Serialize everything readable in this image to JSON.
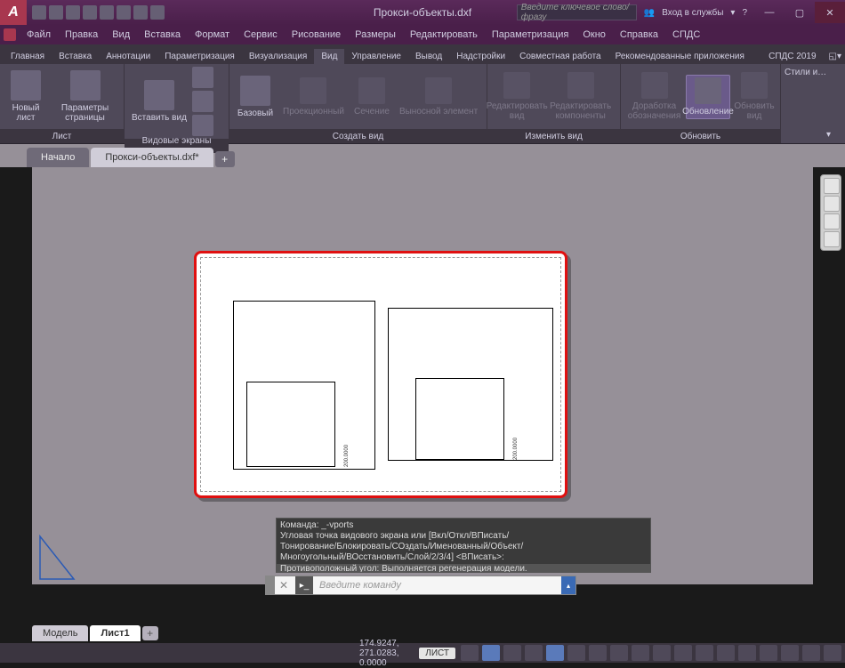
{
  "title": "Прокси-объекты.dxf",
  "search_placeholder": "Введите ключевое слово/фразу",
  "signin": "Вход в службы",
  "menubar": [
    "Файл",
    "Правка",
    "Вид",
    "Вставка",
    "Формат",
    "Сервис",
    "Рисование",
    "Размеры",
    "Редактировать",
    "Параметризация",
    "Окно",
    "Справка",
    "СПДС"
  ],
  "rtabs": [
    "Главная",
    "Вставка",
    "Аннотации",
    "Параметризация",
    "Визуализация",
    "Вид",
    "Управление",
    "Вывод",
    "Надстройки",
    "Совместная работа",
    "Рекомендованные приложения"
  ],
  "rtabs_active": 5,
  "rtabs_right": "СПДС 2019",
  "panels": {
    "sheet": {
      "title": "Лист",
      "new": "Новый лист",
      "pagesetup": "Параметры страницы"
    },
    "viewports": {
      "title": "Видовые экраны листа",
      "insert": "Вставить вид"
    },
    "createview": {
      "title": "Создать вид",
      "base": "Базовый",
      "proj": "Проекционный",
      "section": "Сечение",
      "detail": "Выносной элемент"
    },
    "editview": {
      "title": "Изменить вид",
      "editview_btn": "Редактировать вид",
      "editcomp": "Редактировать компоненты"
    },
    "update": {
      "title": "Обновить",
      "sym": "Доработка обозначения",
      "upd": "Обновление",
      "updview": "Обновить вид"
    },
    "styles": {
      "title": "Стили и…"
    }
  },
  "doctabs": {
    "start": "Начало",
    "active": "Прокси-объекты.dxf*"
  },
  "cmdhist": [
    "Команда: _-vports",
    "Угловая точка видового экрана или [Вкл/Откл/ВПисать/",
    "Тонирование/Блокировать/СОздать/Именованный/Объект/",
    "Многоугольный/ВОсстановить/Слой/2/3/4] <ВПисать>:",
    "Противоположный угол:  Выполняется регенерация модели."
  ],
  "cmdprompt": "Введите команду",
  "layouttabs": {
    "model": "Модель",
    "active": "Лист1"
  },
  "status": {
    "coords": "174.9247, 271.0283, 0.0000",
    "mode": "ЛИСТ"
  }
}
